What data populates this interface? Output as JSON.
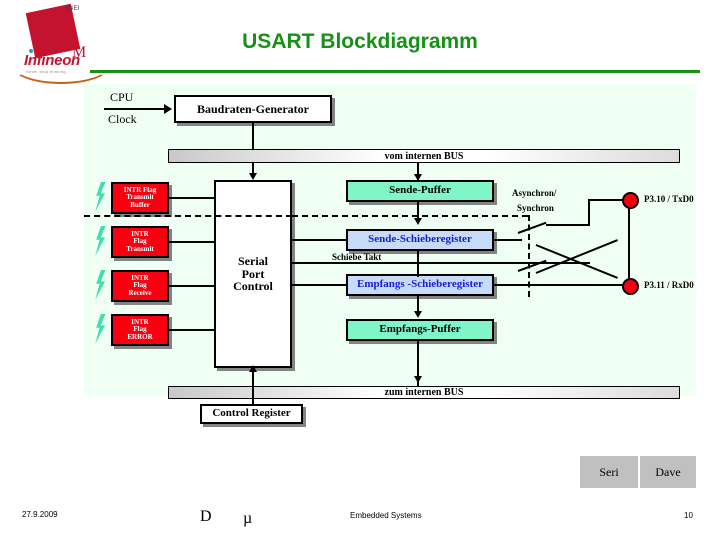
{
  "slide": {
    "title": "USART Blockdiagramm",
    "background": "#ffffff",
    "diagram_background": "#f0fff4",
    "accent_green": "#169116"
  },
  "logo": {
    "wordmark": "Infineon",
    "tagline": "Never stop thinking",
    "tiny_mark": "04EI",
    "letter_m": "M",
    "diamond_color": "#c3132f",
    "swoosh_color": "#c8601a"
  },
  "diagram": {
    "clock_label_line1": "CPU",
    "clock_label_line2": "Clock",
    "baud_generator": "Baudraten-Generator",
    "bus_top": "vom internen BUS",
    "bus_bottom": "zum internen BUS",
    "serial_port_control": "Serial\nPort\nControl",
    "serial_port_control_lines": [
      "Serial",
      "Port",
      "Control"
    ],
    "control_register": "Control Register",
    "interrupt_flags": [
      {
        "lines": [
          "INTR Flag",
          "Transmit",
          "Buffer"
        ],
        "color": "#f90011"
      },
      {
        "lines": [
          "INTR",
          "Flag",
          "Transmit"
        ],
        "color": "#f90011"
      },
      {
        "lines": [
          "INTR",
          "Flag",
          "Receive"
        ],
        "color": "#f90011"
      },
      {
        "lines": [
          "INTR",
          "Flag",
          "ERROR"
        ],
        "color": "#f90011"
      }
    ],
    "data_blocks": [
      {
        "label": "Sende-Puffer",
        "color": "#7ff5c8",
        "text_color": "#000000"
      },
      {
        "label": "Sende-Schieberegister",
        "color": "#c6dbf7",
        "text_color": "#1a1ad0"
      },
      {
        "label": "Empfangs -Schieberegister",
        "color": "#c6dbf7",
        "text_color": "#1a1ad0"
      },
      {
        "label": "Empfangs-Puffer",
        "color": "#7ff5c8",
        "text_color": "#000000"
      }
    ],
    "mode_label_line1": "Asynchron/",
    "mode_label_line2": "Synchron",
    "shift_clock_label": "Schiebe Takt",
    "pins": [
      {
        "label": "P3.10 / TxD0",
        "color": "#f40012"
      },
      {
        "label": "P3.11 / RxD0",
        "color": "#f40012"
      }
    ]
  },
  "footer": {
    "buttons": [
      "Seri",
      "Dave"
    ],
    "date": "27.9.2009",
    "glyph_d": "D",
    "glyph_mu": "µ",
    "course": "Embedded Systems",
    "page_number": "10"
  }
}
